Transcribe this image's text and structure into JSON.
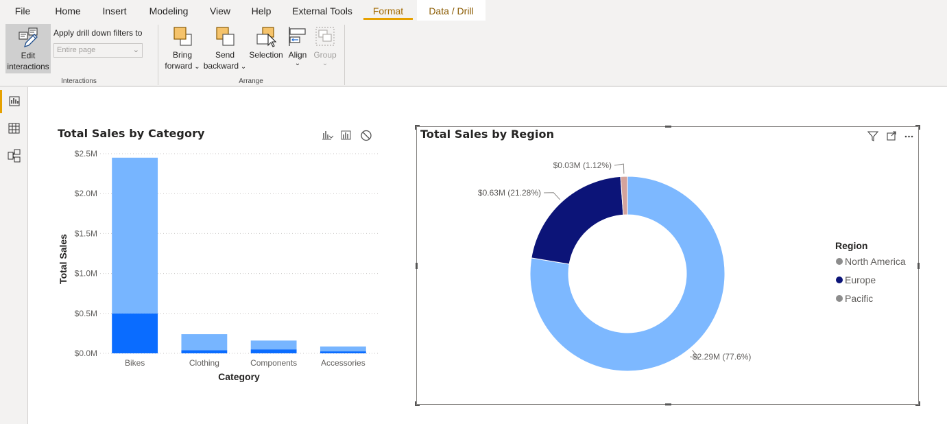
{
  "menu": {
    "tabs": [
      {
        "label": "File"
      },
      {
        "label": "Home"
      },
      {
        "label": "Insert"
      },
      {
        "label": "Modeling"
      },
      {
        "label": "View"
      },
      {
        "label": "Help"
      },
      {
        "label": "External Tools"
      },
      {
        "label": "Format"
      },
      {
        "label": "Data / Drill"
      }
    ],
    "active_tab": "Format",
    "accent_color": "#e6a100"
  },
  "ribbon": {
    "interactions": {
      "group_label": "Interactions",
      "edit_interactions_label_1": "Edit",
      "edit_interactions_label_2": "interactions",
      "drill_filter_label": "Apply drill down filters to",
      "drill_filter_value": "Entire page"
    },
    "arrange": {
      "group_label": "Arrange",
      "bring_forward_1": "Bring",
      "bring_forward_2": "forward",
      "send_backward_1": "Send",
      "send_backward_2": "backward",
      "selection": "Selection",
      "align": "Align",
      "group": "Group"
    }
  },
  "left_rail": [
    {
      "icon": "report-view-icon",
      "active": true
    },
    {
      "icon": "data-view-icon",
      "active": false
    },
    {
      "icon": "model-view-icon",
      "active": false
    }
  ],
  "bar_visual": {
    "title": "Total Sales by Category",
    "header_icons": [
      "drill-mode-icon",
      "expand-hierarchy-icon",
      "no-drill-icon"
    ]
  },
  "donut_visual": {
    "title": "Total Sales by Region",
    "header_icons": [
      "filter-icon",
      "focus-mode-icon",
      "more-options-icon"
    ],
    "legend_title": "Region"
  },
  "chart_data": [
    {
      "type": "bar",
      "title": "Total Sales by Category",
      "xlabel": "Category",
      "ylabel": "Total Sales",
      "categories": [
        "Bikes",
        "Clothing",
        "Components",
        "Accessories"
      ],
      "stacked": true,
      "series": [
        {
          "color": "#0a6cff",
          "values": [
            500000,
            40000,
            50000,
            25000
          ]
        },
        {
          "color": "#77b5ff",
          "values": [
            1950000,
            200000,
            110000,
            60000
          ]
        }
      ],
      "ylim": [
        0,
        2500000
      ],
      "yticks": [
        0,
        500000,
        1000000,
        1500000,
        2000000,
        2500000
      ],
      "ytick_labels": [
        "$0.0M",
        "$0.5M",
        "$1.0M",
        "$1.5M",
        "$2.0M",
        "$2.5M"
      ],
      "grid": true
    },
    {
      "type": "pie",
      "donut": true,
      "title": "Total Sales by Region",
      "legend_title": "Region",
      "legend_position": "right",
      "slices": [
        {
          "label": "North America",
          "value": 2.29,
          "percent": 77.6,
          "color": "#7db8ff",
          "data_label": "$2.29M (77.6%)",
          "legend_color": "#8c8c8c"
        },
        {
          "label": "Europe",
          "value": 0.63,
          "percent": 21.28,
          "color": "#0c1478",
          "data_label": "$0.63M (21.28%)",
          "legend_color": "#0c1478"
        },
        {
          "label": "Pacific",
          "value": 0.03,
          "percent": 1.12,
          "color": "#d4a39c",
          "data_label": "$0.03M (1.12%)",
          "legend_color": "#8c8c8c"
        }
      ]
    }
  ]
}
